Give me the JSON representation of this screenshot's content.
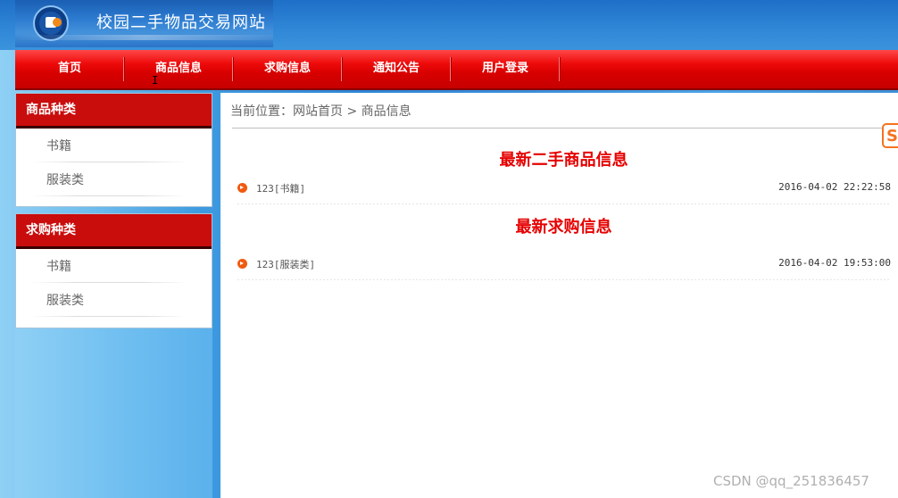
{
  "header": {
    "site_title": "校园二手物品交易网站"
  },
  "nav": {
    "items": [
      {
        "label": "首页"
      },
      {
        "label": "商品信息"
      },
      {
        "label": "求购信息"
      },
      {
        "label": "通知公告"
      },
      {
        "label": "用户登录"
      }
    ]
  },
  "sidebar": {
    "goods_categories": {
      "title": "商品种类",
      "items": [
        {
          "label": "书籍"
        },
        {
          "label": "服装类"
        }
      ]
    },
    "wanted_categories": {
      "title": "求购种类",
      "items": [
        {
          "label": "书籍"
        },
        {
          "label": "服装类"
        }
      ]
    }
  },
  "main": {
    "breadcrumb": "当前位置：网站首页 > 商品信息",
    "latest_goods": {
      "title": "最新二手商品信息",
      "rows": [
        {
          "title": "123[书籍]",
          "time": "2016-04-02 22:22:58"
        }
      ]
    },
    "latest_wanted": {
      "title": "最新求购信息",
      "rows": [
        {
          "title": "123[服装类]",
          "time": "2016-04-02 19:53:00"
        }
      ]
    }
  },
  "corner_badge": "S",
  "watermark": "CSDN @qq_251836457",
  "colors": {
    "nav_red": "#d80000",
    "sidebar_head": "#c90c0c",
    "section_title": "#e60000",
    "row_bullet": "#f05a10"
  },
  "icons": [
    "logo-icon",
    "arrow-bullet-icon"
  ]
}
